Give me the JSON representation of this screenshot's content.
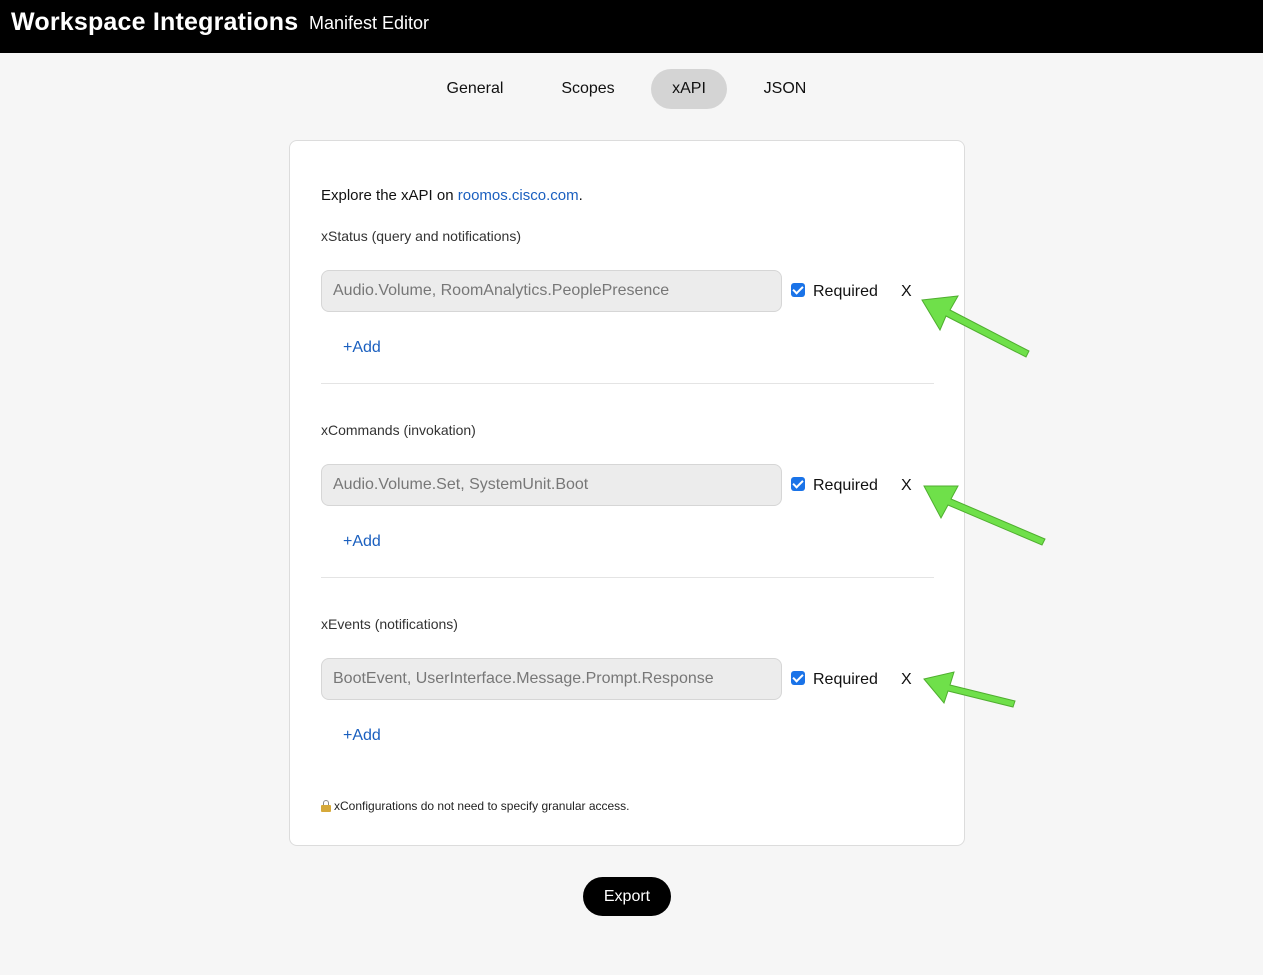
{
  "header": {
    "app_title": "Workspace Integrations",
    "app_subtitle": "Manifest Editor"
  },
  "tabs": [
    {
      "label": "General",
      "active": false
    },
    {
      "label": "Scopes",
      "active": false
    },
    {
      "label": "xAPI",
      "active": true
    },
    {
      "label": "JSON",
      "active": false
    }
  ],
  "card": {
    "intro_text": "Explore the xAPI on ",
    "intro_link": "roomos.cisco.com",
    "intro_suffix": ".",
    "sections": [
      {
        "label": "xStatus (query and notifications)",
        "placeholder": "Audio.Volume, RoomAnalytics.PeoplePresence",
        "required_checked": true,
        "required_label": "Required",
        "remove_label": "X",
        "add_label": "+Add"
      },
      {
        "label": "xCommands (invokation)",
        "placeholder": "Audio.Volume.Set, SystemUnit.Boot",
        "required_checked": true,
        "required_label": "Required",
        "remove_label": "X",
        "add_label": "+Add"
      },
      {
        "label": "xEvents (notifications)",
        "placeholder": "BootEvent, UserInterface.Message.Prompt.Response",
        "required_checked": true,
        "required_label": "Required",
        "remove_label": "X",
        "add_label": "+Add"
      }
    ],
    "note": "xConfigurations do not need to specify granular access."
  },
  "footer": {
    "export_label": "Export"
  },
  "colors": {
    "header_bg": "#000000",
    "link": "#1a5fbf",
    "checkbox": "#1a73e8",
    "annotation_arrow": "#6fe04a"
  }
}
